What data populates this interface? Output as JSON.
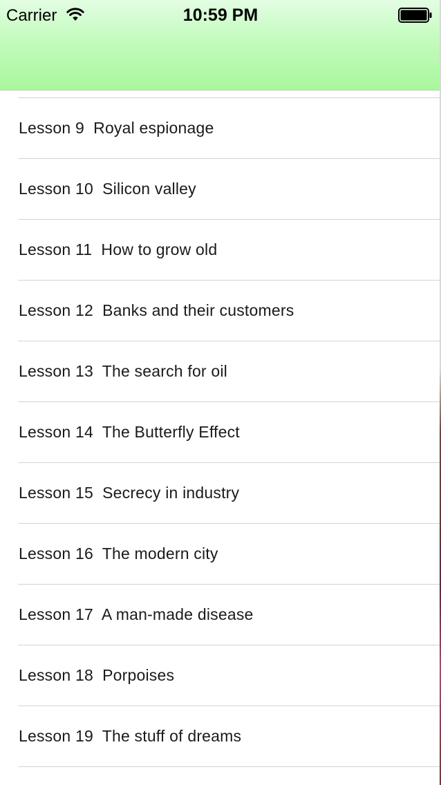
{
  "status_bar": {
    "carrier": "Carrier",
    "time": "10:59 PM",
    "wifi_icon": "wifi-icon",
    "battery_icon": "battery-full-icon"
  },
  "header": {
    "background_top": "#e3fde3",
    "background_bottom": "#a9f79c"
  },
  "lessons": [
    {
      "label": "Lesson 9  Royal espionage"
    },
    {
      "label": "Lesson 10  Silicon valley"
    },
    {
      "label": "Lesson 11  How to grow old"
    },
    {
      "label": "Lesson 12  Banks and their customers"
    },
    {
      "label": "Lesson 13  The search for oil"
    },
    {
      "label": "Lesson 14  The Butterfly Effect"
    },
    {
      "label": "Lesson 15  Secrecy in industry"
    },
    {
      "label": "Lesson 16  The modern city"
    },
    {
      "label": "Lesson 17  A man-made disease"
    },
    {
      "label": "Lesson 18  Porpoises"
    },
    {
      "label": "Lesson 19  The stuff of dreams"
    }
  ]
}
